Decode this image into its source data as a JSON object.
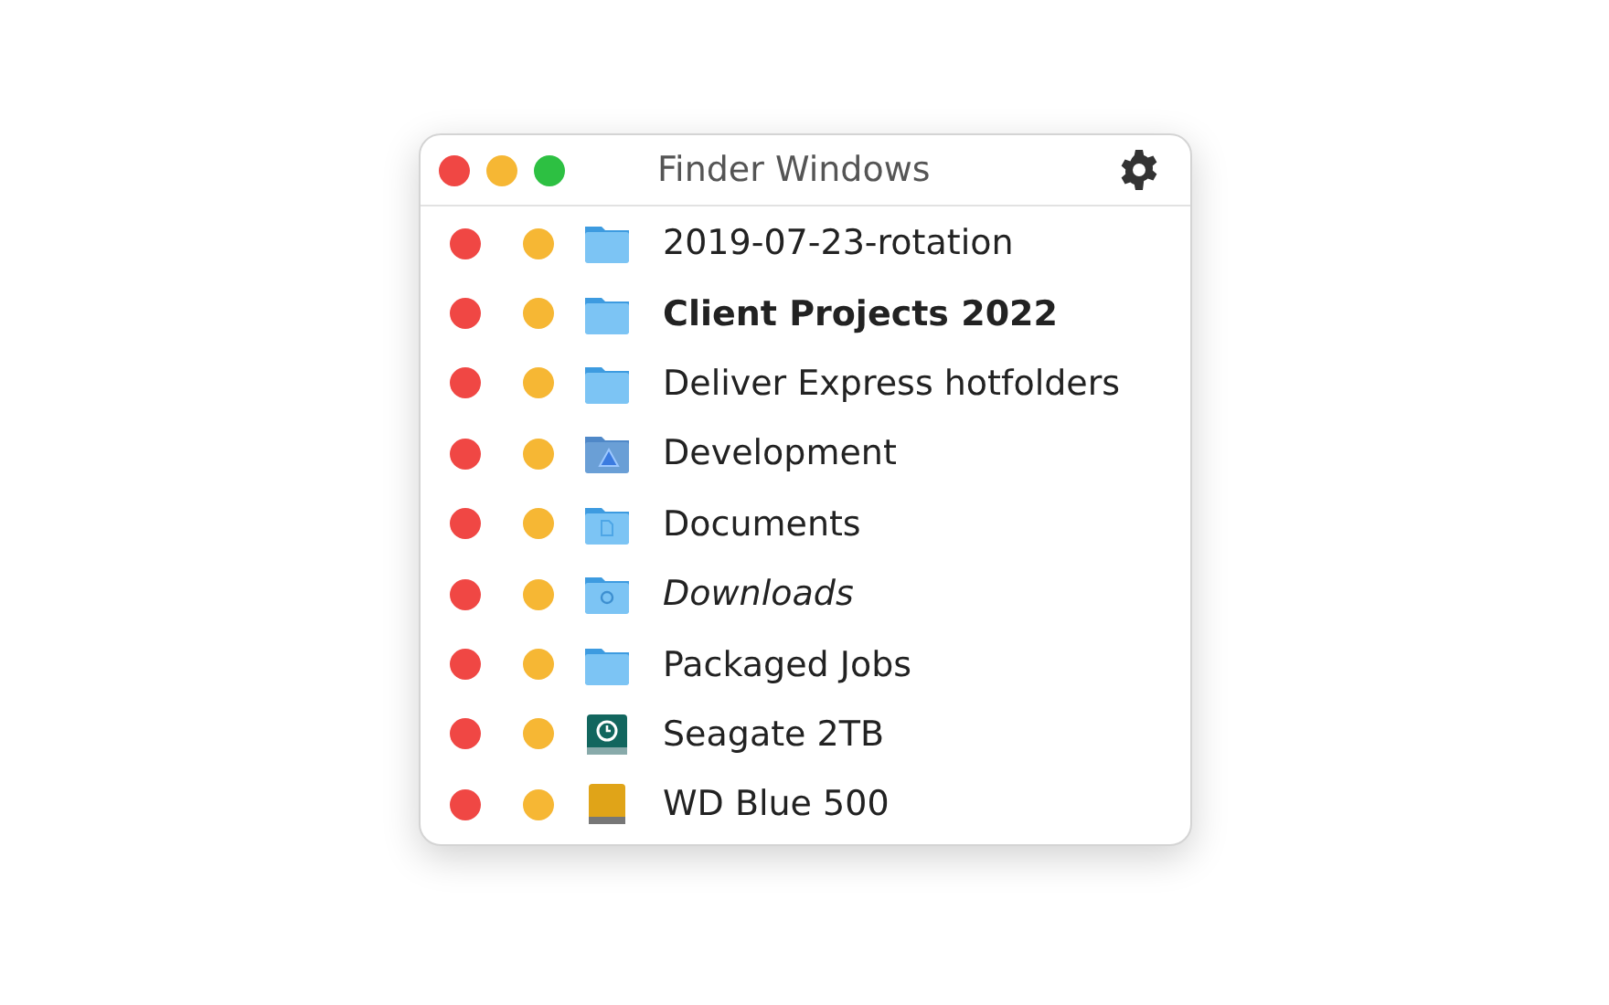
{
  "window": {
    "title": "Finder Windows"
  },
  "rows": [
    {
      "name": "2019-07-23-rotation",
      "kind": "folder",
      "bold": false,
      "italic": false
    },
    {
      "name": "Client Projects 2022",
      "kind": "folder",
      "bold": true,
      "italic": false
    },
    {
      "name": "Deliver Express hotfolders",
      "kind": "folder",
      "bold": false,
      "italic": false
    },
    {
      "name": "Development",
      "kind": "app-folder",
      "bold": false,
      "italic": false
    },
    {
      "name": "Documents",
      "kind": "documents-folder",
      "bold": false,
      "italic": false
    },
    {
      "name": "Downloads",
      "kind": "downloads-folder",
      "bold": false,
      "italic": true
    },
    {
      "name": "Packaged Jobs",
      "kind": "folder",
      "bold": false,
      "italic": false
    },
    {
      "name": "Seagate 2TB",
      "kind": "backup-drive",
      "bold": false,
      "italic": false
    },
    {
      "name": "WD Blue 500",
      "kind": "drive",
      "bold": false,
      "italic": false
    }
  ]
}
